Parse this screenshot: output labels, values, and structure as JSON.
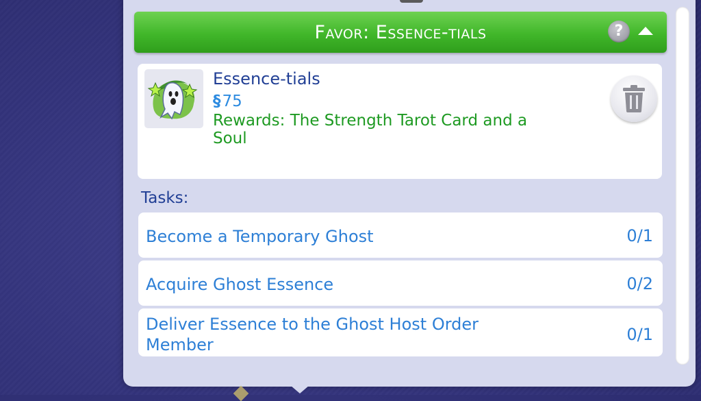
{
  "header": {
    "title": "Favor: Essence-tials",
    "help_label": "?"
  },
  "favor": {
    "name": "Essence-tials",
    "currency_symbol": "§",
    "cost": "75",
    "rewards": "Rewards: The Strength Tarot Card and a Soul"
  },
  "tasks": {
    "heading": "Tasks:",
    "items": [
      {
        "label": "Become a Temporary Ghost",
        "progress": "0/1"
      },
      {
        "label": "Acquire Ghost Essence",
        "progress": "0/2"
      },
      {
        "label": "Deliver Essence to the Ghost Host Order Member",
        "progress": "0/1"
      }
    ]
  },
  "colors": {
    "header_green": "#41b72a",
    "title_blue": "#213f95",
    "task_blue": "#2d7fd6",
    "reward_green": "#1e9a22",
    "panel_bg": "#d6d9ee"
  },
  "icons": {
    "favor_icon": "ghost-icon",
    "delete_icon": "trash-icon",
    "help_icon": "question-icon",
    "collapse_icon": "chevron-up-icon"
  }
}
